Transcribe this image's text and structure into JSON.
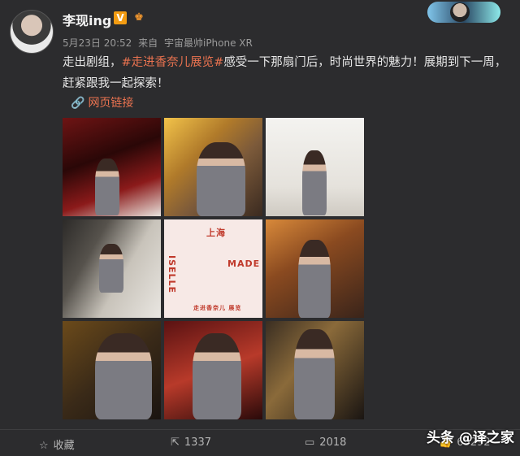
{
  "user": {
    "name": "李现ing",
    "verified_label": "V",
    "level_label": "♚",
    "time": "5月23日 20:52",
    "source_prefix": "来自",
    "source": "宇宙最帅iPhone XR"
  },
  "post": {
    "text_before": "走出剧组，",
    "hashtag": "#走进香奈儿展览#",
    "text_after": "感受一下那扇门后，时尚世界的魅力！展期到下一周，赶紧跟我一起探索！",
    "link_label": "网页链接"
  },
  "poster": {
    "line1": "上海",
    "line2": "ISELLE",
    "line3": "MADE",
    "caption": "走进香奈儿 展览"
  },
  "actions": {
    "favorite": "收藏",
    "repost": "1337",
    "comment": "2018",
    "like": "65292"
  },
  "watermark": "头条 @译之家",
  "colors": {
    "background": "#2c2c2e",
    "accent": "#eb7350"
  }
}
